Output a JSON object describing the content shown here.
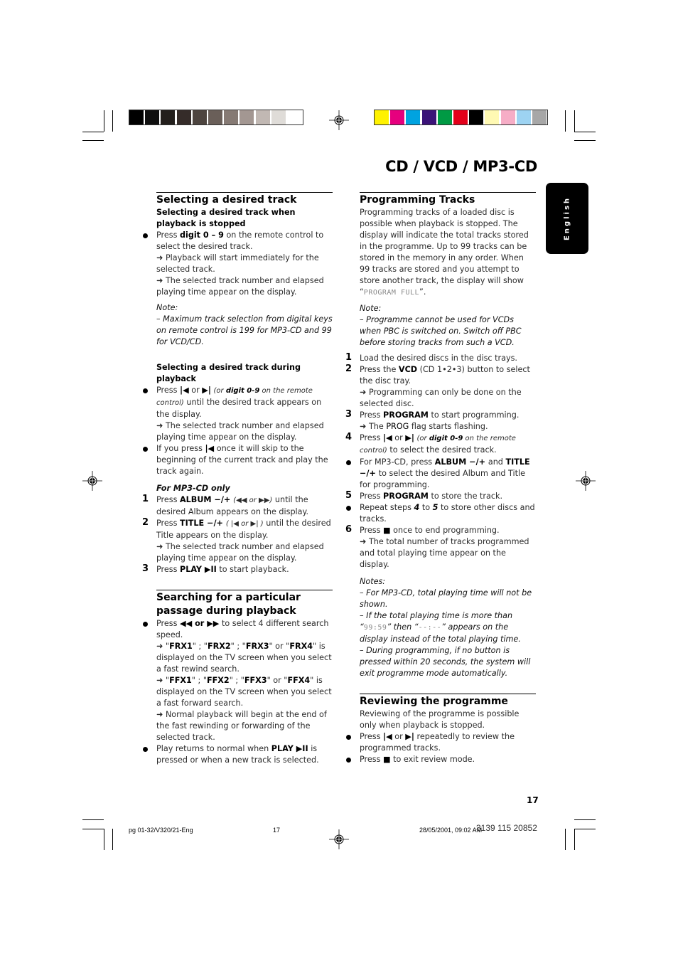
{
  "header": {
    "title": "CD / VCD / MP3-CD",
    "language_tab": "English",
    "gray_swatches": [
      "#000000",
      "#0f0f0f",
      "#231f1c",
      "#352c29",
      "#4d443f",
      "#6a5f59",
      "#867a74",
      "#a39792",
      "#c1b8b3",
      "#dfdcd8",
      "#ffffff"
    ],
    "color_swatches": [
      "#fff200",
      "#e6007e",
      "#00a3e0",
      "#3b1378",
      "#009a44",
      "#e2001a",
      "#000000",
      "#fff9b3",
      "#f6adc6",
      "#9dd3f2",
      "#a7a7a7"
    ]
  },
  "left_column": {
    "section1": {
      "heading": "Selecting a desired track",
      "sub1": "Selecting a desired track when playback is stopped",
      "b1": {
        "pre": "Press ",
        "bold": "digit 0 – 9",
        "post": " on the remote control to select the desired track."
      },
      "b1_arrow1": "Playback will start immediately for the selected track.",
      "b1_arrow2": "The selected track number and elapsed playing time appear on the display.",
      "note_label": "Note:",
      "note_text": "– Maximum track selection from digital keys on remote control is 199 for MP3-CD and 99 for VCD/CD.",
      "sub2": "Selecting a desired track during playback",
      "b2": {
        "pre": "Press ",
        "or": " or ",
        "paren_pre": "(or ",
        "paren_bold": "digit 0-9",
        "paren_post": " on the remote control)",
        "post": " until the desired track appears on the display."
      },
      "b2_arrow": "The selected track number and elapsed playing time appear on the display.",
      "b3": {
        "pre": "If you press ",
        "post": " once it will skip to the beginning of the current track and play the track again."
      },
      "mp3_label": "For MP3-CD only",
      "steps": [
        {
          "num": "1",
          "pre": "Press ",
          "bold": "ALBUM",
          "pm": " −/+ ",
          "paren": "(◀◀ or ▶▶)",
          "post": " until the desired Album appears on the display."
        },
        {
          "num": "2",
          "pre": "Press ",
          "bold": "TITLE",
          "pm": " −/+ ",
          "paren": "( |◀ or ▶| )",
          "post": " until the desired Title appears on the display.",
          "arrow": "The selected track number and elapsed playing time appear on the display."
        },
        {
          "num": "3",
          "pre": "Press ",
          "bold": "PLAY ▶II",
          "post": "  to start playback."
        }
      ]
    },
    "section2": {
      "heading": "Searching for a particular passage during playback",
      "b1": {
        "pre": "Press ",
        "icons": "◀◀ or ▶▶",
        "post": " to select 4 different search speed."
      },
      "frx": {
        "items": [
          "FRX1",
          "FRX2",
          "FRX3",
          "FRX4"
        ],
        "post": "is displayed on the TV screen when you select a fast rewind search."
      },
      "ffx": {
        "items": [
          "FFX1",
          "FFX2",
          "FFX3",
          "FFX4"
        ],
        "post": "displayed on the TV screen when you select a fast forward search."
      },
      "arrow_normal": "Normal playback will begin at the end of the fast rewinding or forwarding of the selected track.",
      "b2": {
        "pre": "Play returns to normal when ",
        "bold": "PLAY ▶II",
        "post": "  is pressed or when a new track is selected."
      }
    }
  },
  "right_column": {
    "section1": {
      "heading": "Programming Tracks",
      "intro": "Programming tracks of a loaded disc is possible when playback is stopped. The display will indicate the total tracks stored in the programme. Up to 99 tracks can be stored in the memory in any order. When 99 tracks are stored and you attempt to store another track, the display will show “",
      "lcd_full": "PROGRAM FULL",
      "intro_end": "”.",
      "note_label": "Note:",
      "note_text": "– Programme cannot be used for VCDs when PBC is switched on. Switch off PBC before storing tracks from such a VCD.",
      "step1": "Load the desired discs in the disc trays.",
      "step2": {
        "pre": "Press the ",
        "bold": "VCD",
        "post": " (CD 1•2•3) button to select the disc tray.",
        "arrow": "Programming can only be done on the selected disc."
      },
      "step3": {
        "pre": "Press ",
        "bold": "PROGRAM",
        "post": " to start programming.",
        "arrow_pre": "The ",
        "arrow_flag": "PROG",
        "arrow_post": " flag starts flashing."
      },
      "step4": {
        "pre": "Press ",
        "or": " or ",
        "paren_pre": "(or ",
        "paren_bold": "digit 0-9",
        "paren_post": " on the remote control)",
        "post": " to select the desired track."
      },
      "bullet_mp3": {
        "pre": "For MP3-CD, press ",
        "bold1": "ALBUM",
        "pm1": " −/+ ",
        "and": "and ",
        "bold2": "TITLE",
        "pm2": "−/+ ",
        "post": "to select the desired Album and Title for programming."
      },
      "step5": {
        "pre": "Press ",
        "bold": "PROGRAM",
        "post": " to store the track."
      },
      "bullet_repeat": {
        "pre": "Repeat steps ",
        "b1": "4",
        "mid": " to ",
        "b2": "5",
        "post": " to store other discs and tracks."
      },
      "step6": {
        "pre": "Press ",
        "post": " once to end programming.",
        "arrow": "The total number of tracks programmed and total playing time appear on the display."
      },
      "notes_label": "Notes:",
      "note1": "– For MP3-CD, total playing time will not be shown.",
      "note2_pre": "– If the total playing time is more than “",
      "note2_lcd1": "99:59",
      "note2_mid": "” then “",
      "note2_lcd2": "--:--",
      "note2_post": "” appears on the display instead of the total playing time.",
      "note3": "– During programming, if no button is pressed within 20 seconds, the system will exit programme mode automatically."
    },
    "section2": {
      "heading": "Reviewing the programme",
      "intro": "Reviewing of the programme is possible only when playback is stopped.",
      "b1": {
        "pre": "Press ",
        "or": " or ",
        "post": " repeatedly to review the programmed tracks."
      },
      "b2": {
        "pre": "Press ",
        "post": " to exit review mode."
      }
    }
  },
  "footer": {
    "page_number": "17",
    "file_label": "pg 01-32/V320/21-Eng",
    "page_small": "17",
    "datetime": "28/05/2001, 09:02 AM",
    "code": "3139 115 20852"
  }
}
